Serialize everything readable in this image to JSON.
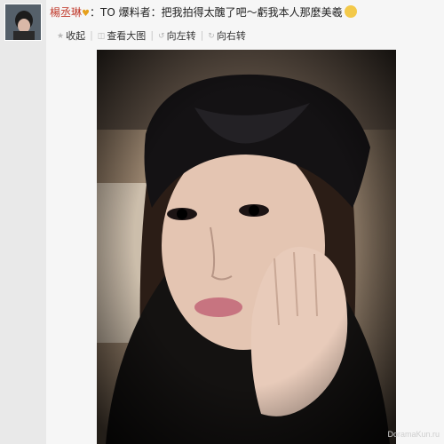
{
  "post": {
    "username": "楊丞琳",
    "vip_badge": "♥",
    "content": "：TO 爆料者：把我拍得太醜了吧～虧我本人那麼美羲"
  },
  "actions": [
    {
      "icon": "star-icon",
      "label": "收起"
    },
    {
      "icon": "zoom-icon",
      "label": "查看大图"
    },
    {
      "icon": "rotate-left-icon",
      "label": "向左转"
    },
    {
      "icon": "rotate-right-icon",
      "label": "向右转"
    }
  ],
  "watermark": "DoramaKun.ru"
}
